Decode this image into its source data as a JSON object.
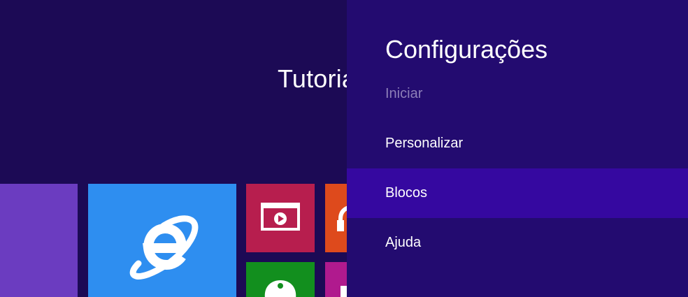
{
  "start_screen": {
    "title": "Tutoria"
  },
  "settings": {
    "title": "Configurações",
    "subtitle": "Iniciar",
    "items": [
      {
        "label": "Personalizar"
      },
      {
        "label": "Blocos",
        "selected": true
      },
      {
        "label": "Ajuda"
      }
    ]
  },
  "colors": {
    "background": "#1c0a55",
    "panel": "#230b70",
    "panel_selected": "#3508a0",
    "tile_purple": "#6b3cc0",
    "tile_ie": "#2e8ef0",
    "tile_video": "#b71e4e",
    "tile_music": "#de4a1c",
    "tile_xbox": "#128f1e",
    "tile_store": "#b01a8e"
  },
  "icons": {
    "ie": "internet-explorer-icon",
    "video": "video-play-icon",
    "music": "headphones-icon",
    "xbox": "xbox-games-icon",
    "store": "store-bag-icon"
  }
}
